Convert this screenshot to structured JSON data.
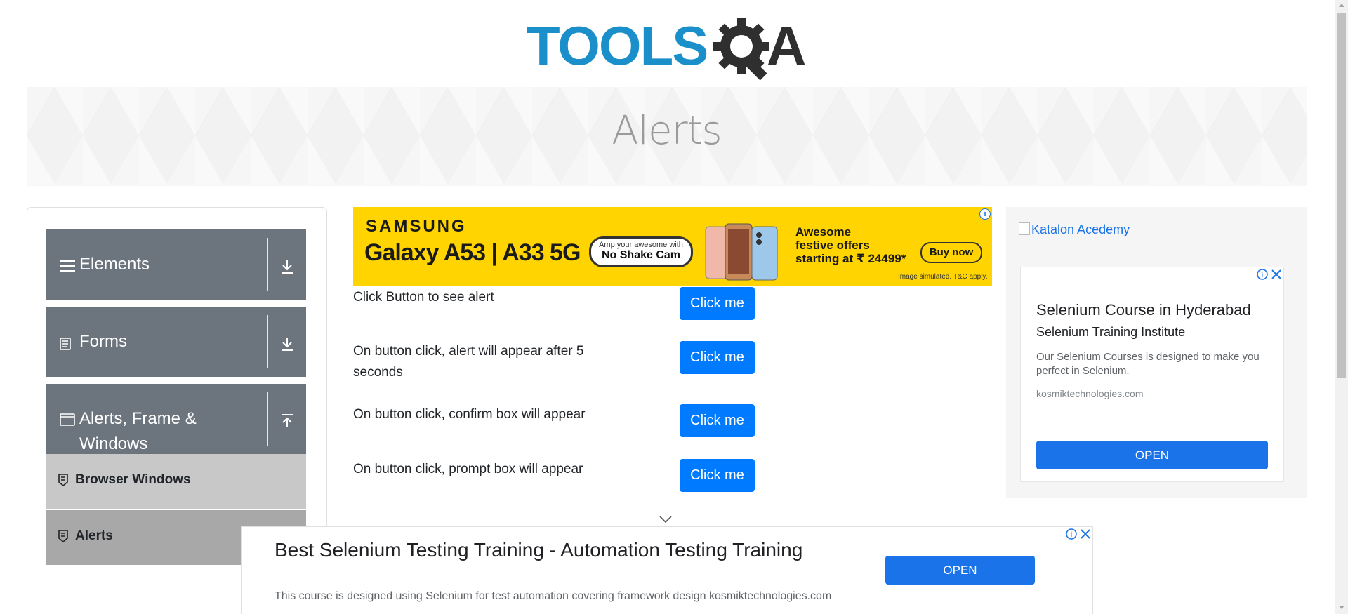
{
  "header": {
    "logo_text": "TOOLS",
    "logo_suffix": "A"
  },
  "banner": {
    "title": "Alerts"
  },
  "sidebar": {
    "groups": [
      {
        "label": "Elements",
        "icon": "hamburger-icon",
        "arrow": "download-arrow-icon"
      },
      {
        "label": "Forms",
        "icon": "document-icon",
        "arrow": "download-arrow-icon"
      },
      {
        "label": "Alerts, Frame & Windows",
        "icon": "window-icon",
        "arrow": "upload-arrow-icon"
      }
    ],
    "sub_items": [
      {
        "label": "Browser Windows",
        "bg": "#c8c8c8"
      },
      {
        "label": "Alerts",
        "bg": "#a8a8a8"
      }
    ]
  },
  "ad_top": {
    "brand": "SAMSUNG",
    "model": "Galaxy A53 | A33 5G",
    "pill_small": "Amp your awesome with",
    "pill_big": "No Shake Cam",
    "offer": [
      "Awesome",
      "festive offers",
      "starting at ₹ 24499*"
    ],
    "buy": "Buy now",
    "disclaimer": "Image simulated. T&C apply.",
    "info": "i"
  },
  "alerts": [
    {
      "text": "Click Button to see alert",
      "button": "Click me"
    },
    {
      "text": "On button click, alert will appear after 5 seconds",
      "button": "Click me"
    },
    {
      "text": "On button click, confirm box will appear",
      "button": "Click me"
    },
    {
      "text": "On button click, prompt box will appear",
      "button": "Click me"
    }
  ],
  "ad_right": {
    "broken_image_alt": "Katalon Acedemy",
    "title": "Selenium Course in Hyderabad",
    "subtitle": "Selenium Training Institute",
    "description": "Our Selenium Courses is designed to make you perfect in Selenium.",
    "url": "kosmiktechnologies.com",
    "open": "OPEN"
  },
  "ad_bottom": {
    "title": "Best Selenium Testing Training - Automation Testing Training",
    "description": "This course is designed using Selenium for test automation covering framework design kosmiktechnologies.com",
    "open": "OPEN"
  },
  "colors": {
    "accent": "#007bff",
    "sidebar_group": "#6c757d",
    "ad_button": "#1a73e8",
    "logo_blue": "#1a8fc9",
    "ad_yellow": "#ffd400"
  }
}
